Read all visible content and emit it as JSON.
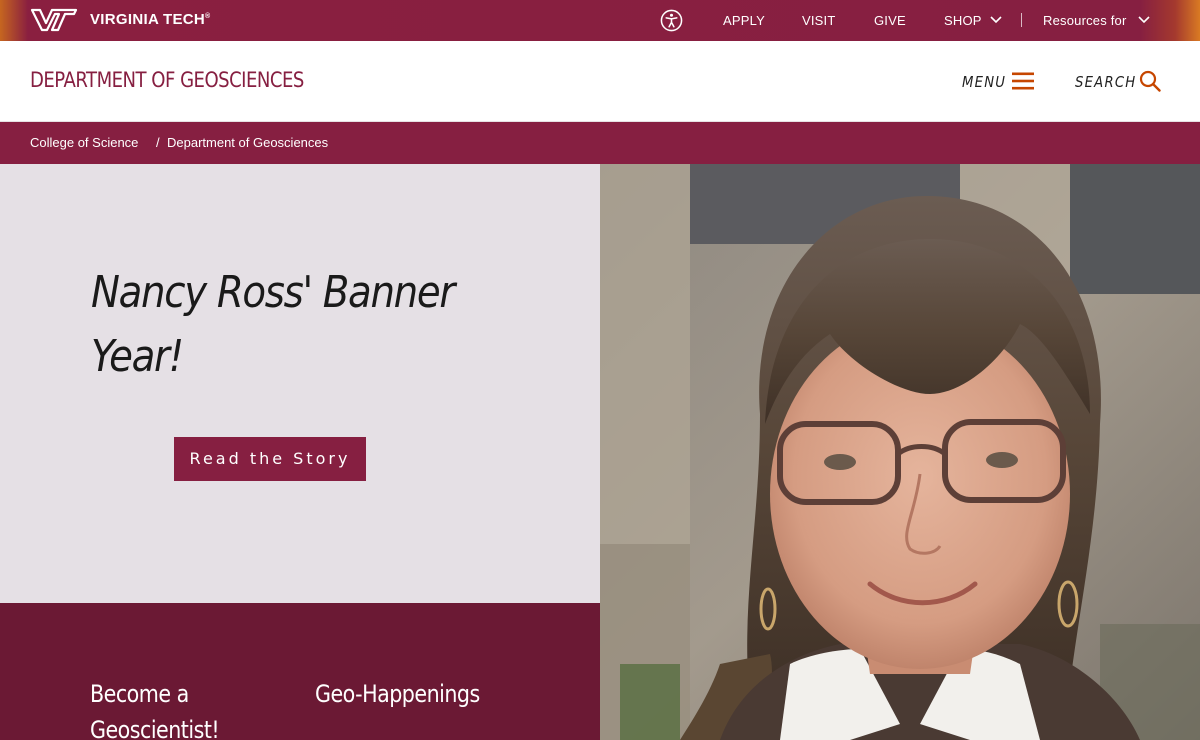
{
  "topbar": {
    "wordmark": "VIRGINIA TECH",
    "wordmark_mark": "®",
    "links": {
      "apply": "APPLY",
      "visit": "VISIT",
      "give": "GIVE",
      "shop": "SHOP",
      "resources": "Resources for"
    }
  },
  "header": {
    "department_title": "DEPARTMENT OF GEOSCIENCES",
    "menu_label": "MENU",
    "search_label": "SEARCH"
  },
  "breadcrumb": {
    "items": [
      "College of Science",
      "Department of Geosciences"
    ],
    "separator": "/"
  },
  "hero": {
    "title_line1": "Nancy Ross' Banner",
    "title_line2": "Year!",
    "button_label": "Read the Story"
  },
  "bottom": {
    "link1_line1": "Become a",
    "link1_line2": "Geoscientist!",
    "link2": "Geo-Happenings"
  },
  "colors": {
    "brand_maroon": "#861f41",
    "dark_maroon": "#6b1934",
    "hero_bg": "#e5e0e5",
    "accent_orange": "#c64600"
  },
  "icons": {
    "logo": "vt-logo-icon",
    "accessibility": "accessibility-icon",
    "dropdown": "chevron-down-icon",
    "menu": "hamburger-icon",
    "search": "search-icon"
  }
}
